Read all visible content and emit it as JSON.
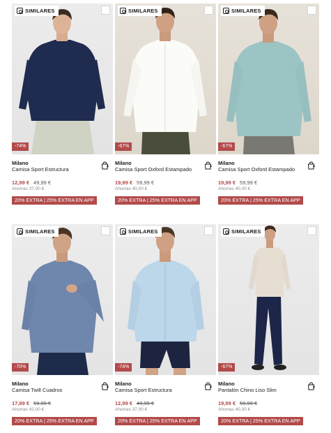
{
  "similares_label": "SIMILARES",
  "promo_label": "20% EXTRA | 25% EXTRA EN APP",
  "colors": {
    "accent": "#b24a4a"
  },
  "products": [
    {
      "discount": "-74%",
      "brand": "Milano",
      "name": "Camisa Sport Estructura",
      "price": "12,99 €",
      "old_price": "49,99 €",
      "savings": "Ahorras 37,00 €",
      "strike": false
    },
    {
      "discount": "-67%",
      "brand": "Milano",
      "name": "Camisa Sport Oxford Estampado",
      "price": "19,99 €",
      "old_price": "59,99 €",
      "savings": "Ahorras 40,00 €",
      "strike": false
    },
    {
      "discount": "-67%",
      "brand": "Milano",
      "name": "Camisa Sport Oxford Estampado",
      "price": "19,99 €",
      "old_price": "59,99 €",
      "savings": "Ahorras 40,00 €",
      "strike": false
    },
    {
      "discount": "-70%",
      "brand": "Milano",
      "name": "Camisa Twill Cuadros",
      "price": "17,99 €",
      "old_price": "59,99 €",
      "savings": "Ahorras 42,00 €",
      "strike": true
    },
    {
      "discount": "-74%",
      "brand": "Milano",
      "name": "Camisa Sport Estructura",
      "price": "12,99 €",
      "old_price": "49,99 €",
      "savings": "Ahorras 37,00 €",
      "strike": true
    },
    {
      "discount": "-67%",
      "brand": "Milano",
      "name": "Pantalón Chino Liso Slim",
      "price": "19,99 €",
      "old_price": "59,99 €",
      "savings": "Ahorras 40,00 €",
      "strike": true
    }
  ]
}
